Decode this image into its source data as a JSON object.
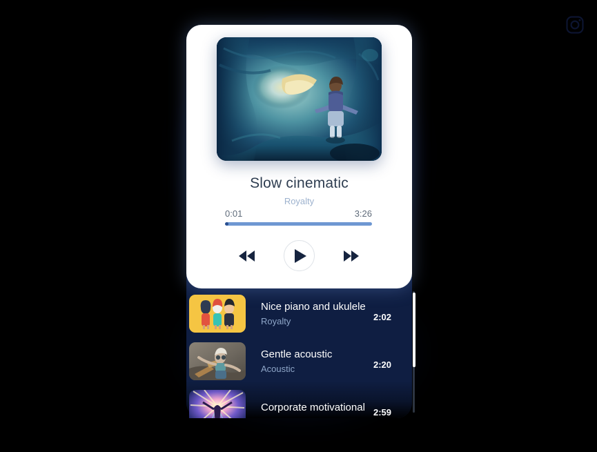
{
  "page": {
    "background_color": "#000000",
    "accent_color": "#6e97d2",
    "panel_color": "#0f1e42"
  },
  "social": {
    "instagram_icon": "instagram-icon"
  },
  "now_playing": {
    "album_art_alt": "boy-in-ice-cave-artwork",
    "title": "Slow cinematic",
    "genre": "Royalty",
    "elapsed": "0:01",
    "duration": "3:26",
    "progress_percent": 2.5
  },
  "controls": {
    "rewind_label": "rewind-icon",
    "play_label": "play-icon",
    "forward_label": "fast-forward-icon"
  },
  "playlist": {
    "tracks": [
      {
        "title": "Nice piano and ukulele",
        "genre": "Royalty",
        "duration": "2:02",
        "thumb": "three-cartoon-kids-yellow"
      },
      {
        "title": "Gentle acoustic",
        "genre": "Acoustic",
        "duration": "2:20",
        "thumb": "vintage-child-toy-plane"
      },
      {
        "title": "Corporate motivational",
        "genre": "",
        "duration": "2:59",
        "thumb": "concert-stage-lights"
      }
    ]
  }
}
